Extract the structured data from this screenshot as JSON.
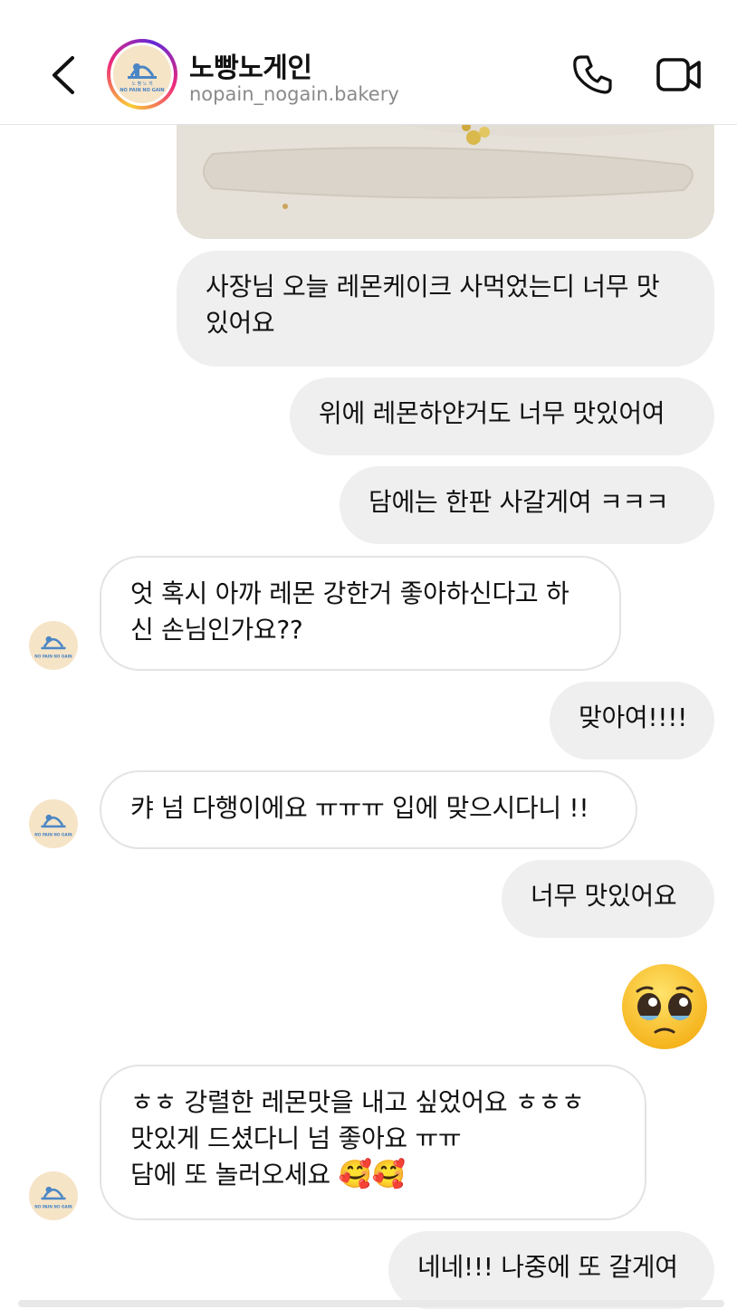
{
  "header": {
    "title": "노빵노게인",
    "username": "nopain_nogain.bakery",
    "logo_text": "NO PAIN NO GAIN",
    "logo_kr": "노 빵  노 게"
  },
  "messages": [
    {
      "side": "out",
      "lines": [
        "사장님 오늘 레몬케이크 사먹었는디 너무 맛",
        "있어요"
      ]
    },
    {
      "side": "out",
      "lines": [
        "위에 레몬하얀거도 너무 맛있어여"
      ]
    },
    {
      "side": "out",
      "lines": [
        "담에는 한판 사갈게여 ㅋㅋㅋ"
      ]
    },
    {
      "side": "in",
      "lines": [
        "엇 혹시 아까 레몬 강한거 좋아하신다고 하",
        "신 손님인가요??"
      ]
    },
    {
      "side": "out",
      "lines": [
        "맞아여!!!!"
      ]
    },
    {
      "side": "in",
      "lines": [
        "캬 넘 다행이에요 ㅠㅠㅠ 입에 맞으시다니 !!"
      ]
    },
    {
      "side": "out",
      "lines": [
        "너무 맛있어요"
      ]
    },
    {
      "side": "out",
      "emoji": "🥹"
    },
    {
      "side": "in",
      "lines": [
        "ㅎㅎ 강렬한 레몬맛을 내고 싶었어요 ㅎㅎㅎ",
        "맛있게 드셨다니 넘 좋아요 ㅠㅠ",
        "담에 또 놀러오세요"
      ],
      "trailing_emoji": "🥰🥰"
    },
    {
      "side": "out",
      "lines": [
        "네네!!! 나중에 또 갈게여"
      ]
    }
  ],
  "colors": {
    "outgoing_bubble": "#efefef",
    "incoming_border": "#e3e3e3",
    "subtitle": "#8a8a8a",
    "logo_bg": "#f6e4c7",
    "logo_blue": "#4a86c5"
  },
  "icons": [
    "back-arrow-icon",
    "phone-icon",
    "video-camera-icon"
  ]
}
